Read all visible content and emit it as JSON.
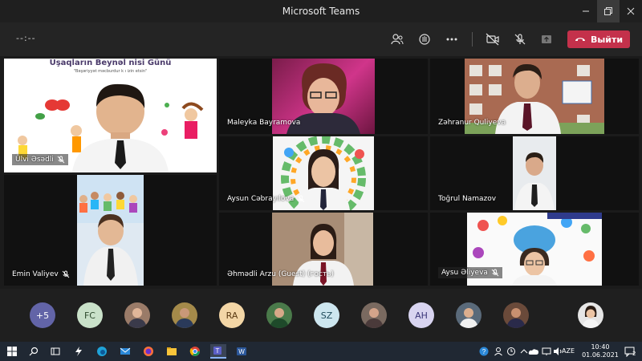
{
  "window": {
    "title": "Microsoft Teams"
  },
  "toolbar": {
    "timer": "--:--",
    "leave_label": "Выйти"
  },
  "tiles": [
    {
      "name": "Ülvi Əsədli",
      "banner": "Uşaqların Beynəl    nisi Günü",
      "banner_sub": "\"Bəşəriyyət məcburdur k                              ı izin etsin\""
    },
    {
      "name": "Maleyka Bayramova"
    },
    {
      "name": "Zəhranur Quliyeva"
    },
    {
      "name": "Emin Valiyev"
    },
    {
      "name": "Aysun Cəbrayılova"
    },
    {
      "name": "Toğrul Namazov"
    },
    {
      "name": "Əhmədli Arzu (Guest) (гость)"
    },
    {
      "name": "Aysu Əliyeva"
    }
  ],
  "roster": [
    {
      "label": "+5",
      "color": "#6264a7"
    },
    {
      "label": "FC",
      "color": "#c9e1c9"
    },
    {
      "label": "",
      "color": "#9a7b68"
    },
    {
      "label": "",
      "color": "#a48a4a"
    },
    {
      "label": "RA",
      "color": "#f3d6a6"
    },
    {
      "label": "",
      "color": "#4a7a4a"
    },
    {
      "label": "SZ",
      "color": "#cde6ef"
    },
    {
      "label": "",
      "color": "#7a6a60"
    },
    {
      "label": "AH",
      "color": "#d8d4f0"
    },
    {
      "label": "",
      "color": "#5a6a7a"
    },
    {
      "label": "",
      "color": "#6a4a3a"
    },
    {
      "label": "",
      "color": "#e6e6e6"
    }
  ],
  "taskbar": {
    "lang": "AZE",
    "time": "10:40",
    "date": "01.06.2021",
    "notif": "2"
  }
}
